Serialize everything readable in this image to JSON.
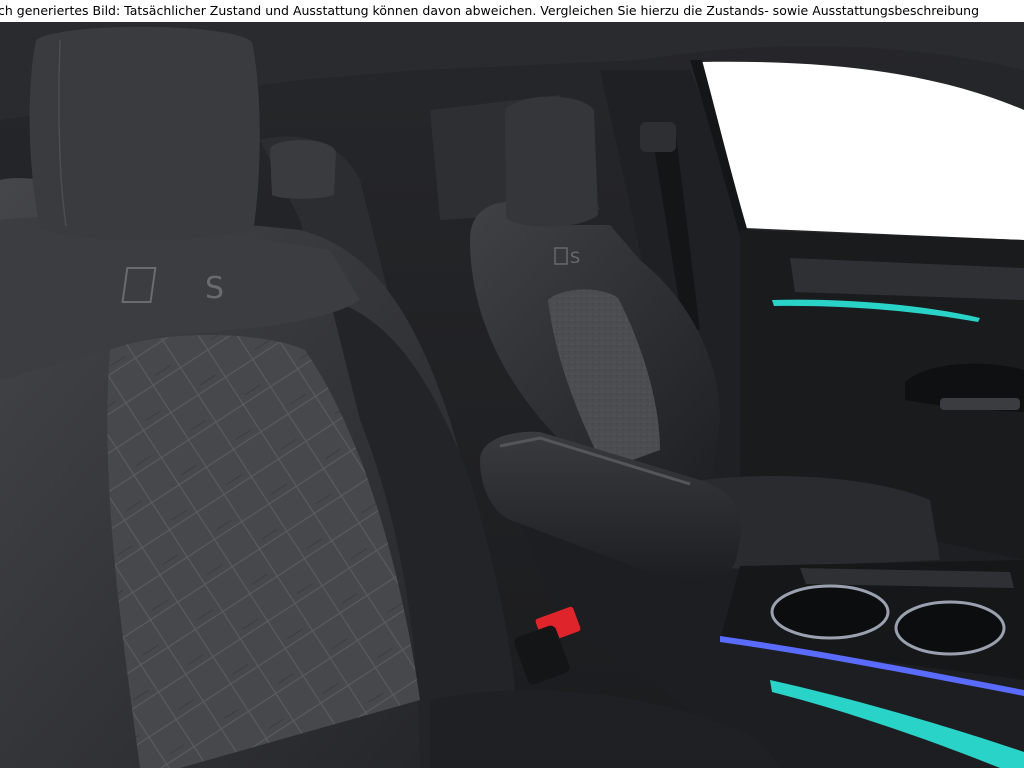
{
  "disclaimer_text": "ch generiertes Bild: Tatsächlicher Zustand und Ausstattung können davon abweichen. Vergleichen Sie hierzu die Zustands- sowie Ausstattungsbeschreibung",
  "seat_badge": "S",
  "colors": {
    "leather": "#2b2c2f",
    "leather_light": "#3d3e42",
    "alcantara": "#4a4b4e",
    "ambient_light": "#29d3c8",
    "ambient_blue": "#5a6cff",
    "buckle_red": "#e0242c",
    "window": "#ffffff"
  },
  "scene": "car-interior-front-seats"
}
